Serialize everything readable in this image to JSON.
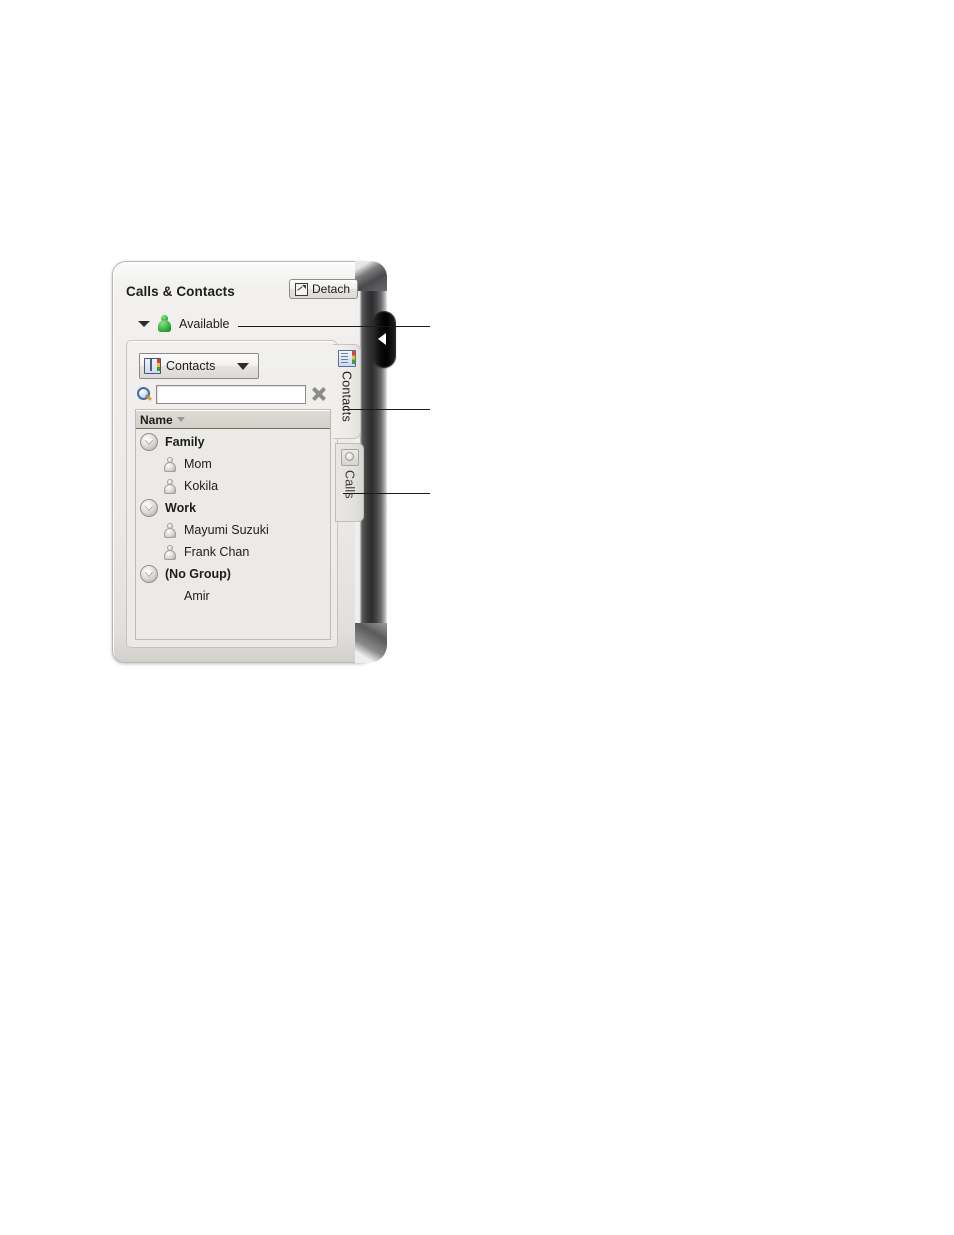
{
  "panel": {
    "title": "Calls & Contacts",
    "detach_label": "Detach",
    "detach_icon": "detach-icon"
  },
  "status": {
    "presence_label": "Available",
    "presence_icon": "presence-available-icon",
    "presence_color": "#35b03a",
    "expander_icon": "caret-down-icon"
  },
  "source_selector": {
    "label": "Contacts",
    "icon": "address-book-icon",
    "caret_icon": "chevron-down-icon"
  },
  "search": {
    "value": "",
    "placeholder": "",
    "search_icon": "magnifier-icon",
    "clear_icon": "clear-x-icon"
  },
  "contact_list": {
    "column_header": "Name",
    "sort_icon": "sort-descending-icon",
    "rows": [
      {
        "label": "Family",
        "kind": "group",
        "icon": "expander-collapse-icon"
      },
      {
        "label": "Mom",
        "kind": "contact",
        "icon": "contact-avatar-icon"
      },
      {
        "label": "Kokila",
        "kind": "contact",
        "icon": "contact-avatar-icon"
      },
      {
        "label": "Work",
        "kind": "group",
        "icon": "expander-collapse-icon"
      },
      {
        "label": "Mayumi Suzuki",
        "kind": "contact",
        "icon": "contact-avatar-icon"
      },
      {
        "label": "Frank Chan",
        "kind": "contact",
        "icon": "contact-avatar-icon"
      },
      {
        "label": "(No Group)",
        "kind": "group",
        "icon": "expander-collapse-icon"
      },
      {
        "label": "Amir",
        "kind": "plain",
        "icon": ""
      }
    ]
  },
  "side_tabs": [
    {
      "label": "Contacts",
      "icon": "contacts-tab-icon",
      "active": true
    },
    {
      "label": "Calls",
      "icon": "calls-tab-icon",
      "active": false
    }
  ],
  "device": {
    "hardware_button_icon": "triangle-left-icon"
  }
}
